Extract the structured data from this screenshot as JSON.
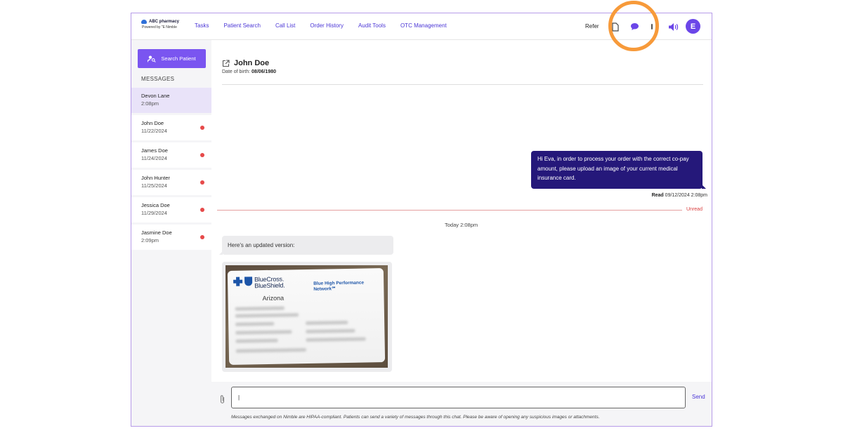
{
  "app": {
    "logo_name": "ABC pharmacy",
    "powered_by": "Powered by \"E Nimble"
  },
  "nav": {
    "items": [
      "Tasks",
      "Patient Search",
      "Call List",
      "Order History",
      "Audit Tools",
      "OTC Management"
    ],
    "refer_label": "Refer",
    "avatar_initial": "E",
    "icons": [
      "document-icon",
      "chat-bubble-icon",
      "phone-icon",
      "speaker-icon"
    ],
    "accent_color": "#7a55f0"
  },
  "sidebar": {
    "search_button": "Search Patient",
    "messages_label": "MESSAGES",
    "contacts": [
      {
        "name": "Devon Lane",
        "time": "2:08pm",
        "unread": false,
        "active": true
      },
      {
        "name": "John Doe",
        "time": "11/22/2024",
        "unread": true
      },
      {
        "name": "James Doe",
        "time": "11/24/2024",
        "unread": true
      },
      {
        "name": "John Hunter",
        "time": "11/25/2024",
        "unread": true
      },
      {
        "name": "Jessica Doe",
        "time": "11/29/2024",
        "unread": true
      },
      {
        "name": "Jasmine Doe",
        "time": "2:09pm",
        "unread": true
      }
    ]
  },
  "chat": {
    "patient_name": "John Doe",
    "dob_label": "Date of birth:",
    "dob_value": "08/06/1980",
    "outgoing_message": "Hi Eva, in order to process your order with the correct co-pay amount, please upload an image of your current medical insurance card.",
    "read_label": "Read",
    "read_time": "09/12/2024 2:08pm",
    "unread_label": "Unread",
    "today_label": "Today 2:08pm",
    "incoming_message": "Here's an updated version:",
    "card": {
      "brand_line1": "BlueCross.",
      "brand_line2": "BlueShield.",
      "state": "Arizona",
      "network_line1": "Blue High Performance",
      "network_line2": "Network℠"
    }
  },
  "composer": {
    "input_value": "|",
    "send_label": "Send",
    "disclaimer": "Messages exchanged on Nimble are HIPAA-compliant. Patients can send a variety of messages through this chat. Please be aware of opening any suspicious images or attachments."
  }
}
